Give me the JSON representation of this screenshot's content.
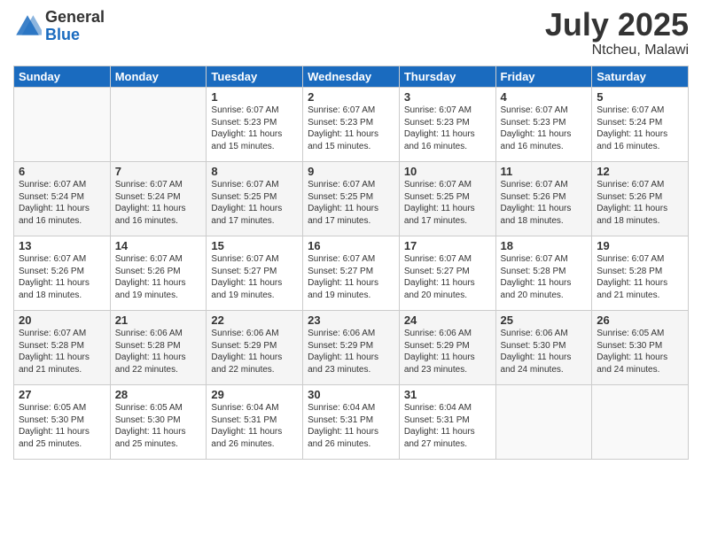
{
  "header": {
    "logo_general": "General",
    "logo_blue": "Blue",
    "month_year": "July 2025",
    "location": "Ntcheu, Malawi"
  },
  "weekdays": [
    "Sunday",
    "Monday",
    "Tuesday",
    "Wednesday",
    "Thursday",
    "Friday",
    "Saturday"
  ],
  "weeks": [
    [
      {
        "day": "",
        "info": ""
      },
      {
        "day": "",
        "info": ""
      },
      {
        "day": "1",
        "info": "Sunrise: 6:07 AM\nSunset: 5:23 PM\nDaylight: 11 hours and 15 minutes."
      },
      {
        "day": "2",
        "info": "Sunrise: 6:07 AM\nSunset: 5:23 PM\nDaylight: 11 hours and 15 minutes."
      },
      {
        "day": "3",
        "info": "Sunrise: 6:07 AM\nSunset: 5:23 PM\nDaylight: 11 hours and 16 minutes."
      },
      {
        "day": "4",
        "info": "Sunrise: 6:07 AM\nSunset: 5:23 PM\nDaylight: 11 hours and 16 minutes."
      },
      {
        "day": "5",
        "info": "Sunrise: 6:07 AM\nSunset: 5:24 PM\nDaylight: 11 hours and 16 minutes."
      }
    ],
    [
      {
        "day": "6",
        "info": "Sunrise: 6:07 AM\nSunset: 5:24 PM\nDaylight: 11 hours and 16 minutes."
      },
      {
        "day": "7",
        "info": "Sunrise: 6:07 AM\nSunset: 5:24 PM\nDaylight: 11 hours and 16 minutes."
      },
      {
        "day": "8",
        "info": "Sunrise: 6:07 AM\nSunset: 5:25 PM\nDaylight: 11 hours and 17 minutes."
      },
      {
        "day": "9",
        "info": "Sunrise: 6:07 AM\nSunset: 5:25 PM\nDaylight: 11 hours and 17 minutes."
      },
      {
        "day": "10",
        "info": "Sunrise: 6:07 AM\nSunset: 5:25 PM\nDaylight: 11 hours and 17 minutes."
      },
      {
        "day": "11",
        "info": "Sunrise: 6:07 AM\nSunset: 5:26 PM\nDaylight: 11 hours and 18 minutes."
      },
      {
        "day": "12",
        "info": "Sunrise: 6:07 AM\nSunset: 5:26 PM\nDaylight: 11 hours and 18 minutes."
      }
    ],
    [
      {
        "day": "13",
        "info": "Sunrise: 6:07 AM\nSunset: 5:26 PM\nDaylight: 11 hours and 18 minutes."
      },
      {
        "day": "14",
        "info": "Sunrise: 6:07 AM\nSunset: 5:26 PM\nDaylight: 11 hours and 19 minutes."
      },
      {
        "day": "15",
        "info": "Sunrise: 6:07 AM\nSunset: 5:27 PM\nDaylight: 11 hours and 19 minutes."
      },
      {
        "day": "16",
        "info": "Sunrise: 6:07 AM\nSunset: 5:27 PM\nDaylight: 11 hours and 19 minutes."
      },
      {
        "day": "17",
        "info": "Sunrise: 6:07 AM\nSunset: 5:27 PM\nDaylight: 11 hours and 20 minutes."
      },
      {
        "day": "18",
        "info": "Sunrise: 6:07 AM\nSunset: 5:28 PM\nDaylight: 11 hours and 20 minutes."
      },
      {
        "day": "19",
        "info": "Sunrise: 6:07 AM\nSunset: 5:28 PM\nDaylight: 11 hours and 21 minutes."
      }
    ],
    [
      {
        "day": "20",
        "info": "Sunrise: 6:07 AM\nSunset: 5:28 PM\nDaylight: 11 hours and 21 minutes."
      },
      {
        "day": "21",
        "info": "Sunrise: 6:06 AM\nSunset: 5:28 PM\nDaylight: 11 hours and 22 minutes."
      },
      {
        "day": "22",
        "info": "Sunrise: 6:06 AM\nSunset: 5:29 PM\nDaylight: 11 hours and 22 minutes."
      },
      {
        "day": "23",
        "info": "Sunrise: 6:06 AM\nSunset: 5:29 PM\nDaylight: 11 hours and 23 minutes."
      },
      {
        "day": "24",
        "info": "Sunrise: 6:06 AM\nSunset: 5:29 PM\nDaylight: 11 hours and 23 minutes."
      },
      {
        "day": "25",
        "info": "Sunrise: 6:06 AM\nSunset: 5:30 PM\nDaylight: 11 hours and 24 minutes."
      },
      {
        "day": "26",
        "info": "Sunrise: 6:05 AM\nSunset: 5:30 PM\nDaylight: 11 hours and 24 minutes."
      }
    ],
    [
      {
        "day": "27",
        "info": "Sunrise: 6:05 AM\nSunset: 5:30 PM\nDaylight: 11 hours and 25 minutes."
      },
      {
        "day": "28",
        "info": "Sunrise: 6:05 AM\nSunset: 5:30 PM\nDaylight: 11 hours and 25 minutes."
      },
      {
        "day": "29",
        "info": "Sunrise: 6:04 AM\nSunset: 5:31 PM\nDaylight: 11 hours and 26 minutes."
      },
      {
        "day": "30",
        "info": "Sunrise: 6:04 AM\nSunset: 5:31 PM\nDaylight: 11 hours and 26 minutes."
      },
      {
        "day": "31",
        "info": "Sunrise: 6:04 AM\nSunset: 5:31 PM\nDaylight: 11 hours and 27 minutes."
      },
      {
        "day": "",
        "info": ""
      },
      {
        "day": "",
        "info": ""
      }
    ]
  ]
}
